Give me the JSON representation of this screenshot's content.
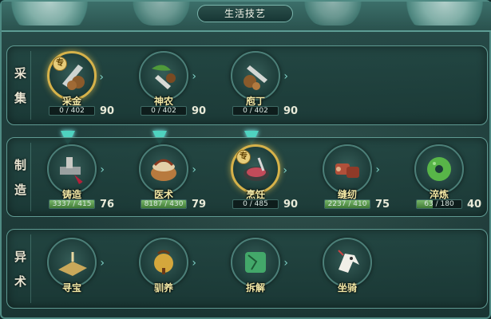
{
  "title": "生活技艺",
  "rows": [
    {
      "label_chars": [
        "采",
        "集"
      ]
    },
    {
      "label_chars": [
        "制",
        "造"
      ]
    },
    {
      "label_chars": [
        "异",
        "术"
      ]
    }
  ],
  "gather": [
    {
      "name": "采金",
      "progress": "0 / 402",
      "level": "90",
      "fill_fraction": 0,
      "icon": "pickaxe-ore-icon",
      "specialty": "专"
    },
    {
      "name": "神农",
      "progress": "0 / 402",
      "level": "90",
      "fill_fraction": 0,
      "icon": "herb-shovel-icon"
    },
    {
      "name": "庖丁",
      "progress": "0 / 402",
      "level": "90",
      "fill_fraction": 0,
      "icon": "butcher-knife-icon"
    }
  ],
  "craft": [
    {
      "name": "铸造",
      "progress": "3337 / 415",
      "level": "76",
      "fill_fraction": 1,
      "icon": "anvil-hammer-icon"
    },
    {
      "name": "医术",
      "progress": "8187 / 430",
      "level": "79",
      "fill_fraction": 1,
      "icon": "medicine-basket-icon"
    },
    {
      "name": "烹饪",
      "progress": "0 / 485",
      "level": "90",
      "fill_fraction": 0,
      "icon": "cooking-pan-icon",
      "specialty": "专"
    },
    {
      "name": "缝纫",
      "progress": "2237 / 410",
      "level": "75",
      "fill_fraction": 1,
      "icon": "fabric-roll-icon"
    },
    {
      "name": "淬炼",
      "progress": "63 / 180",
      "level": "40",
      "fill_fraction": 0.35,
      "icon": "jade-disc-icon"
    }
  ],
  "arcane": [
    {
      "name": "寻宝",
      "icon": "sundial-icon"
    },
    {
      "name": "驯养",
      "icon": "bell-icon"
    },
    {
      "name": "拆解",
      "icon": "broken-tablet-icon"
    },
    {
      "name": "坐骑",
      "icon": "horse-icon"
    }
  ],
  "colors": {
    "accent": "#d6b24a",
    "name_text": "#f3e9a6",
    "arrow": "#4fd3c0"
  }
}
